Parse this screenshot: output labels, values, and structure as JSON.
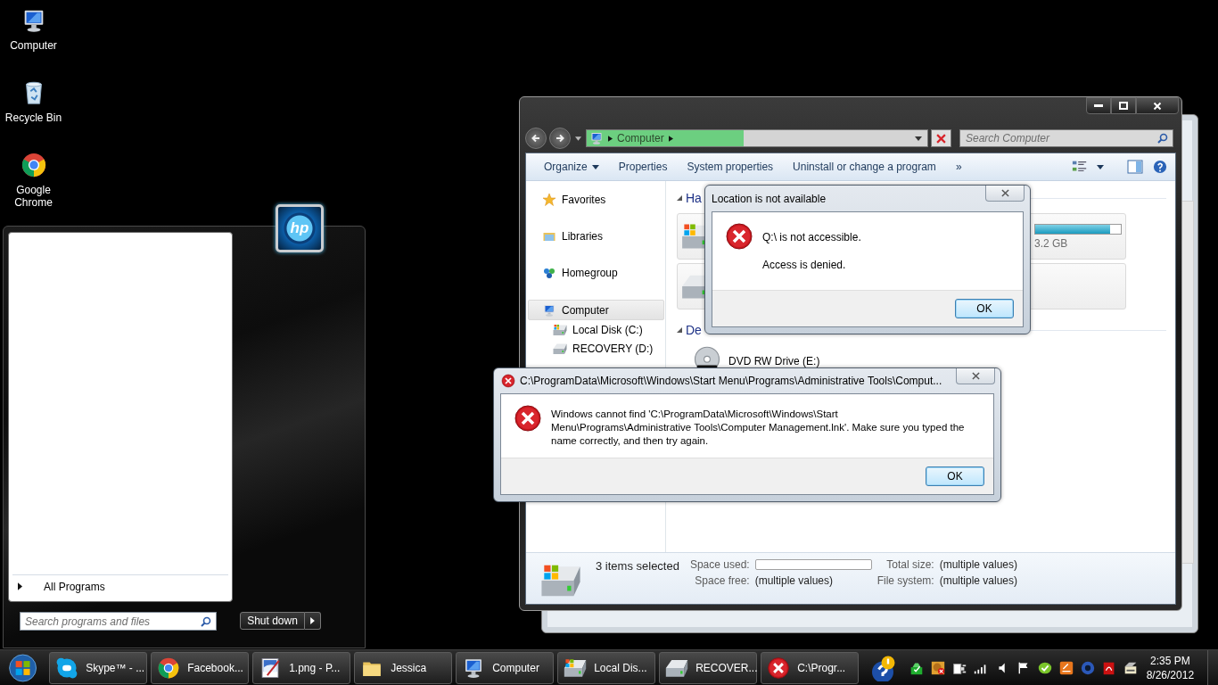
{
  "desktop_icons": [
    {
      "label": "Computer",
      "kind": "computer"
    },
    {
      "label": "Recycle Bin",
      "kind": "recycle"
    },
    {
      "label": "Google Chrome",
      "kind": "chrome"
    }
  ],
  "start_menu": {
    "logo": "hp",
    "all_programs": "All Programs",
    "search_placeholder": "Search programs and files",
    "shutdown": "Shut down"
  },
  "explorer": {
    "address": {
      "text": "Computer",
      "level": 0.46
    },
    "search_placeholder": "Search Computer",
    "commands": [
      {
        "label": "Organize",
        "kind": "menu"
      },
      {
        "label": "Properties",
        "kind": "plain"
      },
      {
        "label": "System properties",
        "kind": "plain"
      },
      {
        "label": "Uninstall or change a program",
        "kind": "plain"
      },
      {
        "label": "»",
        "kind": "plain"
      }
    ],
    "nav": [
      {
        "label": "Favorites",
        "kind": "star",
        "selected": false
      },
      {
        "label": "Libraries",
        "kind": "library",
        "selected": false
      },
      {
        "label": "Homegroup",
        "kind": "homegroup",
        "selected": false
      },
      {
        "label": "Computer",
        "kind": "computer",
        "selected": true,
        "children": [
          {
            "label": "Local Disk (C:)",
            "kind": "windisk",
            "selected": false
          },
          {
            "label": "RECOVERY (D:)",
            "kind": "disk",
            "selected": false
          }
        ]
      }
    ],
    "groups": [
      {
        "heading": "Ha",
        "kind": "tiles",
        "items": [
          {
            "kind": "windisk",
            "level": 0.87,
            "size": "3.2 GB"
          },
          {
            "kind": "disk"
          }
        ]
      },
      {
        "heading": "De",
        "kind": "list",
        "items": [
          {
            "kind": "dvd",
            "label": "DVD RW Drive (E:)"
          }
        ]
      }
    ],
    "status": {
      "selection": "3 items selected",
      "fields": [
        {
          "label": "Space used:",
          "kind": "bar",
          "level": 0
        },
        {
          "label": "Total size:",
          "kind": "text",
          "value": "(multiple values)"
        },
        {
          "label": "Space free:",
          "kind": "text",
          "value": "(multiple values)"
        },
        {
          "label": "File system:",
          "kind": "text",
          "value": "(multiple values)"
        }
      ]
    }
  },
  "dialogs": [
    {
      "title": "Location is not available",
      "title_icon": false,
      "lines": [
        "Q:\\ is not accessible.",
        "Access is denied."
      ],
      "button": "OK"
    },
    {
      "title": "C:\\ProgramData\\Microsoft\\Windows\\Start Menu\\Programs\\Administrative Tools\\Comput...",
      "title_icon": true,
      "lines": [
        "Windows cannot find 'C:\\ProgramData\\Microsoft\\Windows\\Start Menu\\Programs\\Administrative Tools\\Computer Management.lnk'. Make sure you typed the name correctly, and then try again."
      ],
      "button": "OK"
    }
  ],
  "taskbar": {
    "buttons": [
      {
        "label": "Skype™ - ...",
        "kind": "skype"
      },
      {
        "label": "Facebook...",
        "kind": "chrome"
      },
      {
        "label": "1.png - P...",
        "kind": "paint"
      },
      {
        "label": "Jessica",
        "kind": "folder"
      },
      {
        "label": "Computer",
        "kind": "computer"
      },
      {
        "label": "Local Dis...",
        "kind": "windisk"
      },
      {
        "label": "RECOVER...",
        "kind": "disk"
      },
      {
        "label": "C:\\Progr...",
        "kind": "error"
      }
    ],
    "clock": {
      "time": "2:35 PM",
      "date": "8/26/2012"
    }
  }
}
